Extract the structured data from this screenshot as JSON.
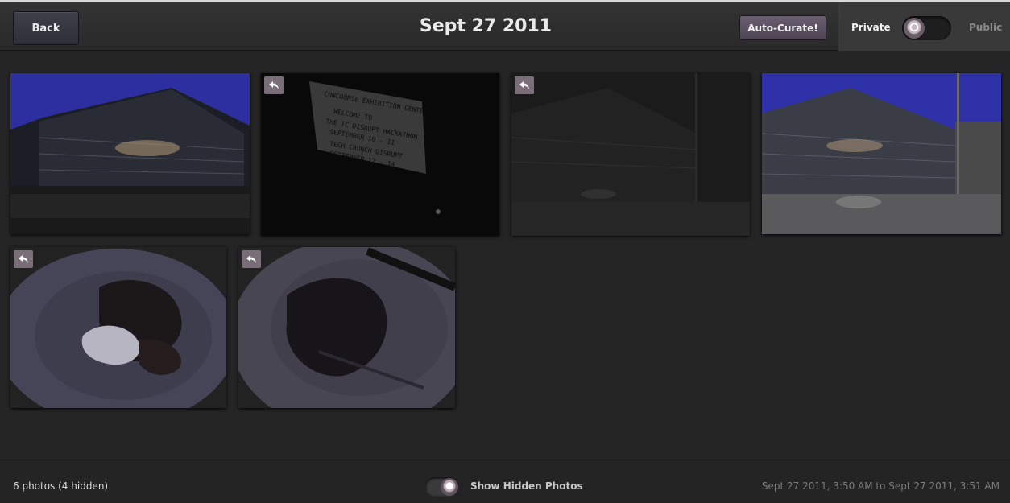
{
  "header": {
    "back_label": "Back",
    "title": "Sept 27 2011",
    "auto_curate_label": "Auto-Curate!",
    "privacy": {
      "private_label": "Private",
      "public_label": "Public",
      "selected": "Private"
    }
  },
  "photos": [
    {
      "subject": "convention center at dusk",
      "hidden": false
    },
    {
      "subject": "welcome sign",
      "hidden": true
    },
    {
      "subject": "dark building exterior",
      "hidden": true
    },
    {
      "subject": "convention center plaza",
      "hidden": false
    },
    {
      "subject": "dessert plate",
      "hidden": true
    },
    {
      "subject": "chocolate cake slice",
      "hidden": true
    }
  ],
  "footer": {
    "count_text": "6 photos (4 hidden)",
    "show_hidden_label": "Show Hidden Photos",
    "date_range": "Sept 27 2011, 3:50 AM to Sept 27 2011, 3:51 AM"
  },
  "colors": {
    "background": "#252525",
    "header": "#2f2f2f",
    "accent_button": "#5c5061",
    "hide_badge": "#7a6f78"
  },
  "icons": {
    "hide_badge": "undo-arrow-icon",
    "toggle_knob": "fingerprint-knob-icon"
  }
}
